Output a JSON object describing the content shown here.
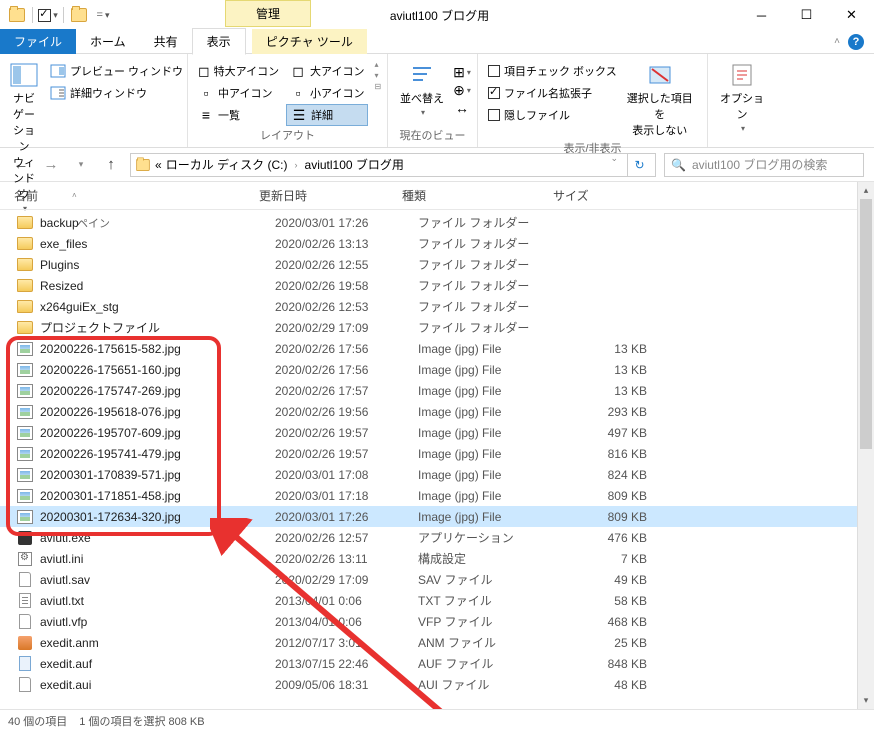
{
  "title": "aviutl100 ブログ用",
  "tabs": {
    "file": "ファイル",
    "home": "ホーム",
    "share": "共有",
    "view": "表示",
    "contextual_header": "管理",
    "contextual_tab": "ピクチャ ツール"
  },
  "ribbon": {
    "pane": {
      "nav": "ナビゲーション\nウィンドウ",
      "preview": "プレビュー ウィンドウ",
      "details": "詳細ウィンドウ",
      "label": "ペイン"
    },
    "layout": {
      "xl_icons": "特大アイコン",
      "l_icons": "大アイコン",
      "m_icons": "中アイコン",
      "s_icons": "小アイコン",
      "list": "一覧",
      "details": "詳細",
      "label": "レイアウト"
    },
    "current": {
      "sort": "並べ替え",
      "label": "現在のビュー"
    },
    "show": {
      "checkboxes": "項目チェック ボックス",
      "ext": "ファイル名拡張子",
      "hidden": "隠しファイル",
      "hide_selected": "選択した項目を\n表示しない",
      "label": "表示/非表示"
    },
    "options": {
      "btn": "オプション"
    }
  },
  "breadcrumb": {
    "p1": "ローカル ディスク (C:)",
    "p2": "aviutl100 ブログ用"
  },
  "search": {
    "placeholder": "aviutl100 ブログ用の検索"
  },
  "columns": {
    "name": "名前",
    "date": "更新日時",
    "type": "種類",
    "size": "サイズ"
  },
  "files": [
    {
      "icon": "folder",
      "name": "backup",
      "date": "2020/03/01 17:26",
      "type": "ファイル フォルダー",
      "size": ""
    },
    {
      "icon": "folder",
      "name": "exe_files",
      "date": "2020/02/26 13:13",
      "type": "ファイル フォルダー",
      "size": ""
    },
    {
      "icon": "folder",
      "name": "Plugins",
      "date": "2020/02/26 12:55",
      "type": "ファイル フォルダー",
      "size": ""
    },
    {
      "icon": "folder",
      "name": "Resized",
      "date": "2020/02/26 19:58",
      "type": "ファイル フォルダー",
      "size": ""
    },
    {
      "icon": "folder",
      "name": "x264guiEx_stg",
      "date": "2020/02/26 12:53",
      "type": "ファイル フォルダー",
      "size": ""
    },
    {
      "icon": "folder",
      "name": "プロジェクトファイル",
      "date": "2020/02/29 17:09",
      "type": "ファイル フォルダー",
      "size": ""
    },
    {
      "icon": "img",
      "name": "20200226-175615-582.jpg",
      "date": "2020/02/26 17:56",
      "type": "Image (jpg) File",
      "size": "13 KB"
    },
    {
      "icon": "img",
      "name": "20200226-175651-160.jpg",
      "date": "2020/02/26 17:56",
      "type": "Image (jpg) File",
      "size": "13 KB"
    },
    {
      "icon": "img",
      "name": "20200226-175747-269.jpg",
      "date": "2020/02/26 17:57",
      "type": "Image (jpg) File",
      "size": "13 KB"
    },
    {
      "icon": "img",
      "name": "20200226-195618-076.jpg",
      "date": "2020/02/26 19:56",
      "type": "Image (jpg) File",
      "size": "293 KB"
    },
    {
      "icon": "img",
      "name": "20200226-195707-609.jpg",
      "date": "2020/02/26 19:57",
      "type": "Image (jpg) File",
      "size": "497 KB"
    },
    {
      "icon": "img",
      "name": "20200226-195741-479.jpg",
      "date": "2020/02/26 19:57",
      "type": "Image (jpg) File",
      "size": "816 KB"
    },
    {
      "icon": "img",
      "name": "20200301-170839-571.jpg",
      "date": "2020/03/01 17:08",
      "type": "Image (jpg) File",
      "size": "824 KB"
    },
    {
      "icon": "img",
      "name": "20200301-171851-458.jpg",
      "date": "2020/03/01 17:18",
      "type": "Image (jpg) File",
      "size": "809 KB"
    },
    {
      "icon": "img",
      "name": "20200301-172634-320.jpg",
      "date": "2020/03/01 17:26",
      "type": "Image (jpg) File",
      "size": "809 KB",
      "selected": true
    },
    {
      "icon": "exe",
      "name": "aviutl.exe",
      "date": "2020/02/26 12:57",
      "type": "アプリケーション",
      "size": "476 KB"
    },
    {
      "icon": "ini",
      "name": "aviutl.ini",
      "date": "2020/02/26 13:11",
      "type": "構成設定",
      "size": "7 KB"
    },
    {
      "icon": "file",
      "name": "aviutl.sav",
      "date": "2020/02/29 17:09",
      "type": "SAV ファイル",
      "size": "49 KB"
    },
    {
      "icon": "txt",
      "name": "aviutl.txt",
      "date": "2013/04/01 0:06",
      "type": "TXT ファイル",
      "size": "58 KB"
    },
    {
      "icon": "file",
      "name": "aviutl.vfp",
      "date": "2013/04/01 0:06",
      "type": "VFP ファイル",
      "size": "468 KB"
    },
    {
      "icon": "anm",
      "name": "exedit.anm",
      "date": "2012/07/17 3:01",
      "type": "ANM ファイル",
      "size": "25 KB"
    },
    {
      "icon": "auf",
      "name": "exedit.auf",
      "date": "2013/07/15 22:46",
      "type": "AUF ファイル",
      "size": "848 KB"
    },
    {
      "icon": "file",
      "name": "exedit.aui",
      "date": "2009/05/06 18:31",
      "type": "AUI ファイル",
      "size": "48 KB"
    }
  ],
  "status": {
    "count": "40 個の項目",
    "selected": "1 個の項目を選択 808 KB"
  }
}
